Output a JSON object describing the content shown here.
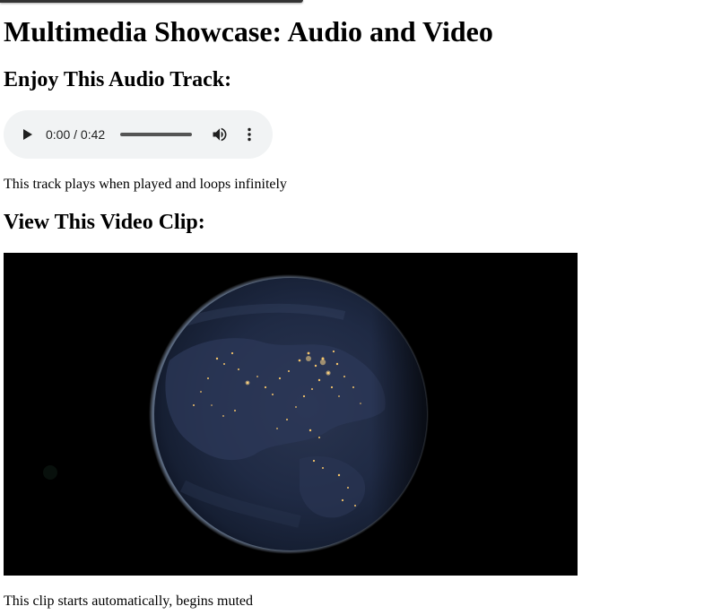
{
  "page": {
    "title": "Multimedia Showcase: Audio and Video"
  },
  "audio_section": {
    "heading": "Enjoy This Audio Track:",
    "player": {
      "current_time": "0:00",
      "separator": "/",
      "duration": "0:42",
      "time_display": "0:00 / 0:42",
      "progress_fraction": 0,
      "icons": {
        "play": "play-icon",
        "volume": "volume-icon",
        "more": "more-options-icon"
      }
    },
    "caption": "This track plays when played and loops infinitely"
  },
  "video_section": {
    "heading": "View This Video Clip:",
    "caption": "This clip starts automatically, begins muted",
    "frame": {
      "subject": "earth-at-night-image"
    }
  },
  "colors": {
    "player_background": "#f1f3f4",
    "video_background": "#000000"
  }
}
